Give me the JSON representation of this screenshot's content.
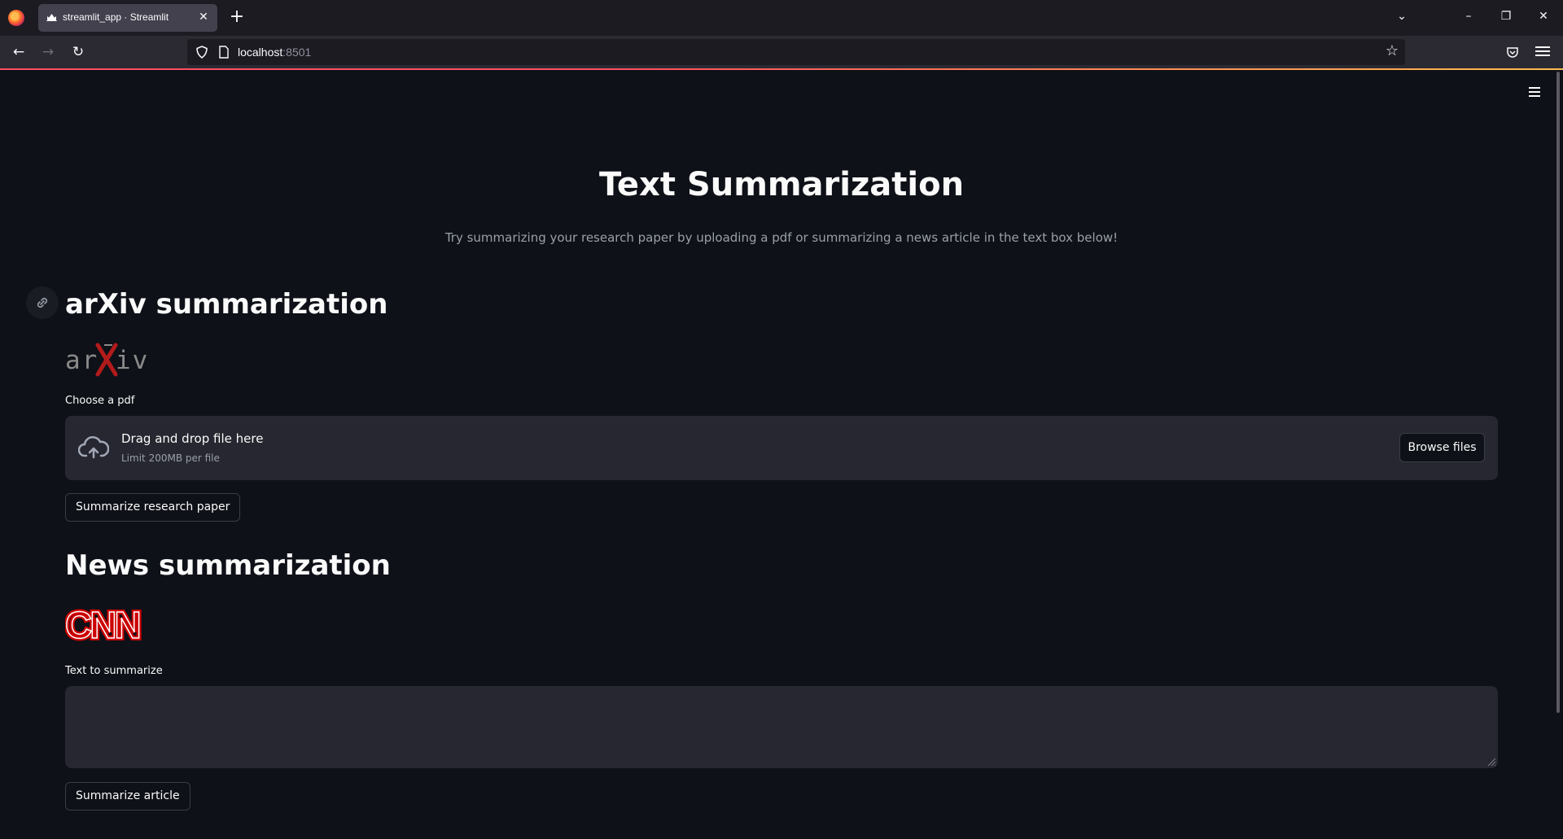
{
  "browser": {
    "tab_title": "streamlit_app · Streamlit",
    "url_host": "localhost",
    "url_port": ":8501"
  },
  "app": {
    "title": "Text Summarization",
    "subtitle": "Try summarizing your research paper by uploading a pdf or summarizing a news article in the text box below!",
    "arxiv": {
      "heading": "arXiv summarization",
      "logo_text": "arXiv",
      "upload_label": "Choose a pdf",
      "dropzone_text": "Drag and drop file here",
      "dropzone_limit": "Limit 200MB per file",
      "browse_label": "Browse files",
      "button_label": "Summarize research paper"
    },
    "news": {
      "heading": "News summarization",
      "logo_text": "CNN",
      "text_label": "Text to summarize",
      "text_value": "",
      "button_label": "Summarize article"
    }
  },
  "colors": {
    "background": "#0e1117",
    "widget_bg": "#262730",
    "cnn_red": "#cc0000",
    "arxiv_red": "#b31b1b"
  }
}
